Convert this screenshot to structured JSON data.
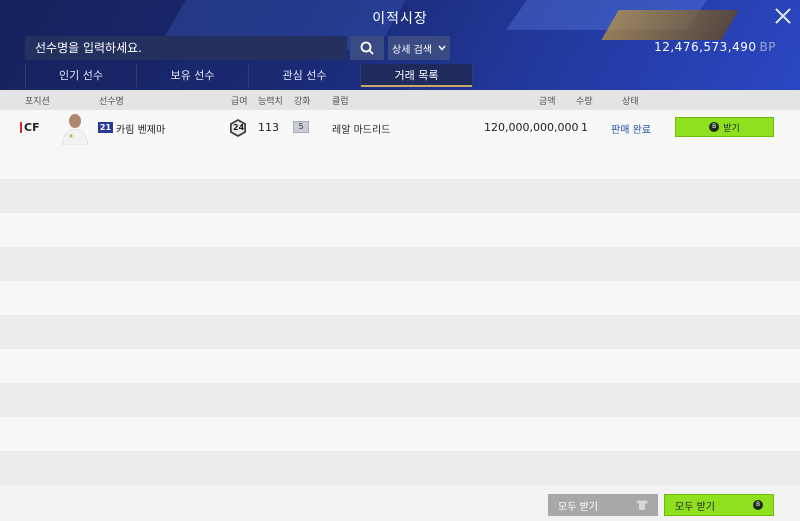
{
  "window": {
    "title": "이적시장"
  },
  "search": {
    "placeholder": "선수명을 입력하세요.",
    "detail_label": "상세 검색"
  },
  "balance": {
    "amount": "12,476,573,490",
    "unit": "BP"
  },
  "tabs": [
    {
      "label": "인기 선수",
      "active": false
    },
    {
      "label": "보유 선수",
      "active": false
    },
    {
      "label": "관심 선수",
      "active": false
    },
    {
      "label": "거래 목록",
      "active": true
    }
  ],
  "columns": {
    "position": "포지션",
    "name": "선수명",
    "salary": "급여",
    "ovr": "능력치",
    "enhance": "강화",
    "club": "클럽",
    "price": "금액",
    "qty": "수량",
    "status": "상태"
  },
  "rows": [
    {
      "position": "CF",
      "season": "21",
      "name": "카림 벤제마",
      "salary": "24",
      "ovr": "113",
      "enhance": "5",
      "club": "레알 마드리드",
      "price": "120,000,000,000",
      "qty": "1",
      "status": "판매 완료",
      "action": "받기"
    }
  ],
  "footer": {
    "receive_all_gray": "모두 받기",
    "receive_all_green": "모두 받기"
  },
  "colors": {
    "accent_green": "#8fe01f",
    "status_blue": "#2150a8",
    "header_dark": "#16215a"
  },
  "icons": {
    "search": "search-icon",
    "chevron": "chevron-down-icon",
    "close": "close-icon",
    "coin": "coin-icon",
    "shirt": "shirt-icon"
  }
}
